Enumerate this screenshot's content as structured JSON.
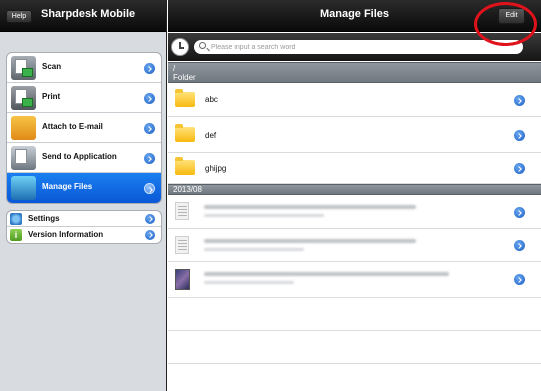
{
  "left_pane": {
    "help_label": "Help",
    "app_title": "Sharpdesk Mobile",
    "menu_items": [
      {
        "label": "Scan",
        "icon": "scan-icon"
      },
      {
        "label": "Print",
        "icon": "print-icon"
      },
      {
        "label": "Attach to E-mail",
        "icon": "mail-icon"
      },
      {
        "label": "Send to Application",
        "icon": "send-icon"
      },
      {
        "label": "Manage Files",
        "icon": "manage-files-icon",
        "active": true
      }
    ],
    "settings_items": [
      {
        "label": "Settings",
        "icon": "gear-icon"
      },
      {
        "label": "Version Information",
        "icon": "info-icon",
        "glyph": "i"
      }
    ]
  },
  "right_pane": {
    "title": "Manage Files",
    "edit_label": "Edit",
    "search": {
      "placeholder": "Please input a search word"
    },
    "path": "/",
    "folder_section": "Folder",
    "folders": [
      "abc",
      "def",
      "ghijpg"
    ],
    "date_section": "2013/08"
  },
  "colors": {
    "navbar": "#0a0a0a",
    "active_item": "#0a58d6",
    "highlight_ring": "#e0121b",
    "folder": "#f7b90e"
  }
}
